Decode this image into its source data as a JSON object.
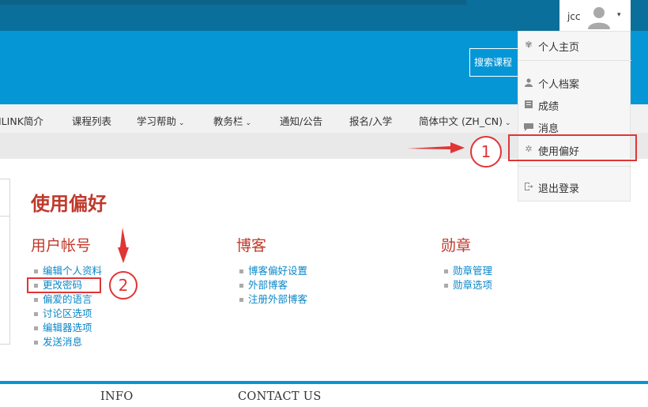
{
  "user": {
    "name": "jcc"
  },
  "header": {
    "search_button": "搜索课程"
  },
  "nav": {
    "items": [
      {
        "label": "ILINK简介",
        "has_menu": false
      },
      {
        "label": "课程列表",
        "has_menu": false
      },
      {
        "label": "学习帮助",
        "has_menu": true
      },
      {
        "label": "教务栏",
        "has_menu": true
      },
      {
        "label": "通知/公告",
        "has_menu": false
      },
      {
        "label": "报名/入学",
        "has_menu": false
      },
      {
        "label": "简体中文 (ZH_CN)",
        "has_menu": true
      }
    ],
    "chevron": "⌄"
  },
  "page": {
    "title": "使用偏好",
    "sections": [
      {
        "title": "用户帐号",
        "links": [
          "编辑个人资料",
          "更改密码",
          "偏爱的语言",
          "讨论区选项",
          "编辑器选项",
          "发送消息"
        ]
      },
      {
        "title": "博客",
        "links": [
          "博客偏好设置",
          "外部博客",
          "注册外部博客"
        ]
      },
      {
        "title": "勋章",
        "links": [
          "勋章管理",
          "勋章选项"
        ]
      }
    ]
  },
  "user_menu": {
    "items": [
      {
        "label": "个人主页",
        "icon": "dashboard-icon"
      },
      {
        "label": "个人档案",
        "icon": "user-icon"
      },
      {
        "label": "成绩",
        "icon": "grades-icon"
      },
      {
        "label": "消息",
        "icon": "message-icon"
      },
      {
        "label": "使用偏好",
        "icon": "gear-icon"
      },
      {
        "label": "退出登录",
        "icon": "logout-icon"
      }
    ]
  },
  "annotations": {
    "step1": "1",
    "step2": "2"
  },
  "footer": {
    "info": "INFO",
    "contact": "CONTACT US"
  },
  "colors": {
    "topbar": "#0a6f9a",
    "band": "#0596d6",
    "heading": "#c0392b",
    "link": "#0a87c9",
    "annotation": "#e03535"
  }
}
